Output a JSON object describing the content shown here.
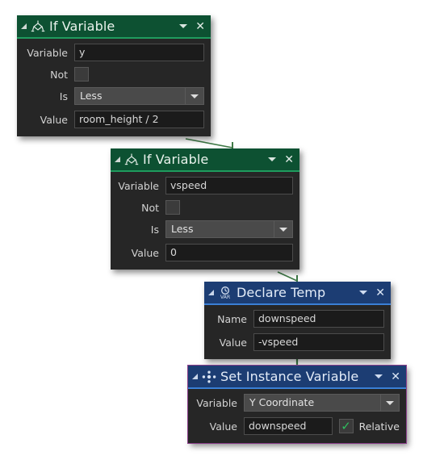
{
  "canvas": {
    "background": "#ffffff",
    "connector_color": "#3e7a46"
  },
  "theme": {
    "green_title": "#0d5132",
    "green_accent": "#1f9c5e",
    "blue_title": "#1c3d73",
    "blue_accent": "#3a7fd5",
    "body_bg": "#262626",
    "field_bg": "#1b1b1b",
    "combo_bg": "#4a4a4a",
    "selection_outline": "#8b3f8b",
    "check_color": "#2fbf5e"
  },
  "blocks": [
    {
      "id": "if-variable-y",
      "title": "If Variable",
      "icon": "branch-diamond-icon",
      "header_color": "green",
      "selected": false,
      "caret_label": "▼",
      "close_label": "✕",
      "fields": {
        "variable_label": "Variable",
        "variable_value": "y",
        "not_label": "Not",
        "not_checked": false,
        "is_label": "Is",
        "is_value": "Less",
        "value_label": "Value",
        "value_value": "room_height / 2"
      }
    },
    {
      "id": "if-variable-vspeed",
      "title": "If Variable",
      "icon": "branch-diamond-icon",
      "header_color": "green",
      "selected": false,
      "caret_label": "▼",
      "close_label": "✕",
      "fields": {
        "variable_label": "Variable",
        "variable_value": "vspeed",
        "not_label": "Not",
        "not_checked": false,
        "is_label": "Is",
        "is_value": "Less",
        "value_label": "Value",
        "value_value": "0"
      }
    },
    {
      "id": "declare-temp",
      "title": "Declare Temp",
      "icon": "var-clock-icon",
      "header_color": "blue",
      "selected": false,
      "caret_label": "▼",
      "close_label": "✕",
      "fields": {
        "name_label": "Name",
        "name_value": "downspeed",
        "value_label": "Value",
        "value_value": "-vspeed"
      }
    },
    {
      "id": "set-instance-variable",
      "title": "Set Instance Variable",
      "icon": "instance-dots-icon",
      "header_color": "blue",
      "selected": true,
      "caret_label": "▼",
      "close_label": "✕",
      "fields": {
        "variable_label": "Variable",
        "variable_value": "Y Coordinate",
        "value_label": "Value",
        "value_value": "downspeed",
        "relative_label": "Relative",
        "relative_checked": true,
        "check_glyph": "✓"
      }
    }
  ]
}
